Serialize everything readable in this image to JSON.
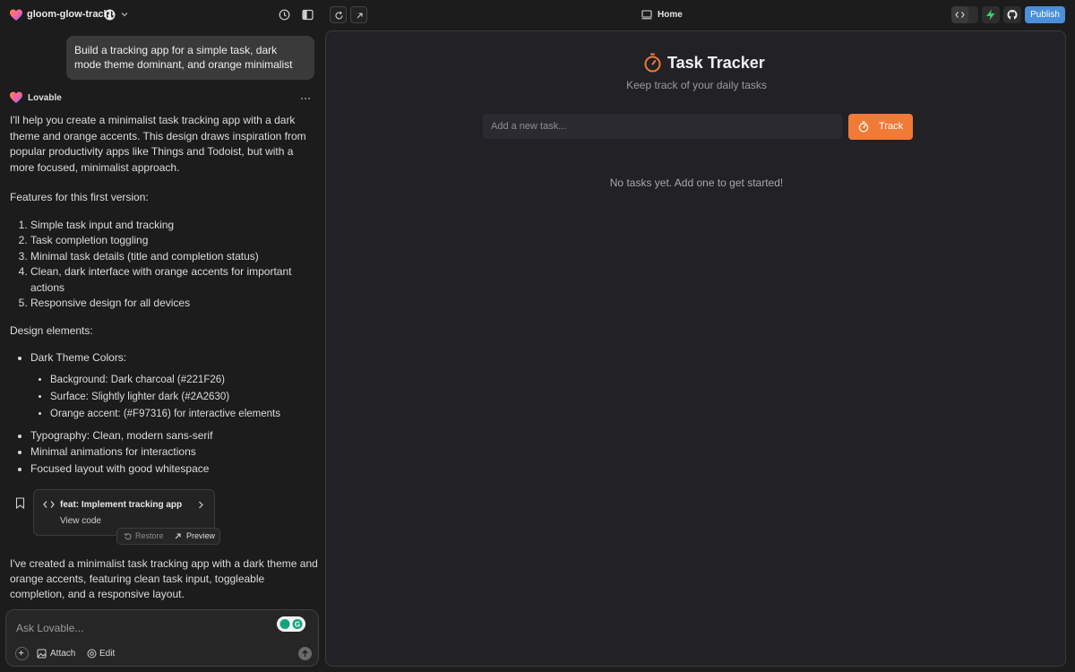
{
  "project": {
    "name": "gloom-glow-track"
  },
  "chat": {
    "user_message": "Build a tracking app for a simple task, dark mode theme dominant, and orange minimalist",
    "assistant_name": "Lovable",
    "intro": "I'll help you create a minimalist task tracking app with a dark theme and orange accents. This design draws inspiration from popular productivity apps like Things and Todoist, but with a more focused, minimalist approach.",
    "features_heading": "Features for this first version:",
    "features": [
      "Simple task input and tracking",
      "Task completion toggling",
      "Minimal task details (title and completion status)",
      "Clean, dark interface with orange accents for important actions",
      "Responsive design for all devices"
    ],
    "design_heading": "Design elements:",
    "design": {
      "colors_heading": "Dark Theme Colors:",
      "colors": [
        "Background: Dark charcoal (#221F26)",
        "Surface: Slightly lighter dark (#2A2630)",
        "Orange accent: (#F97316) for interactive elements"
      ],
      "items": [
        "Typography: Clean, modern sans-serif",
        "Minimal animations for interactions",
        "Focused layout with good whitespace"
      ]
    },
    "commit": {
      "title": "feat: Implement tracking app",
      "view_code": "View code",
      "restore": "Restore",
      "preview": "Preview"
    },
    "final_message": "I've created a minimalist task tracking app with a dark theme and orange accents, featuring clean task input, toggleable completion, and a responsive layout."
  },
  "composer": {
    "placeholder": "Ask Lovable...",
    "attach": "Attach",
    "edit": "Edit"
  },
  "toolbar": {
    "route": "Home",
    "publish": "Publish"
  },
  "preview": {
    "title": "Task Tracker",
    "subtitle": "Keep track of your daily tasks",
    "input_placeholder": "Add a new task...",
    "track_button": "Track",
    "empty_message": "No tasks yet. Add one to get started!"
  },
  "colors": {
    "accent": "#F07A36",
    "preview_bg": "#222126",
    "surface": "#2A2A30",
    "publish": "#4A8FD9"
  }
}
